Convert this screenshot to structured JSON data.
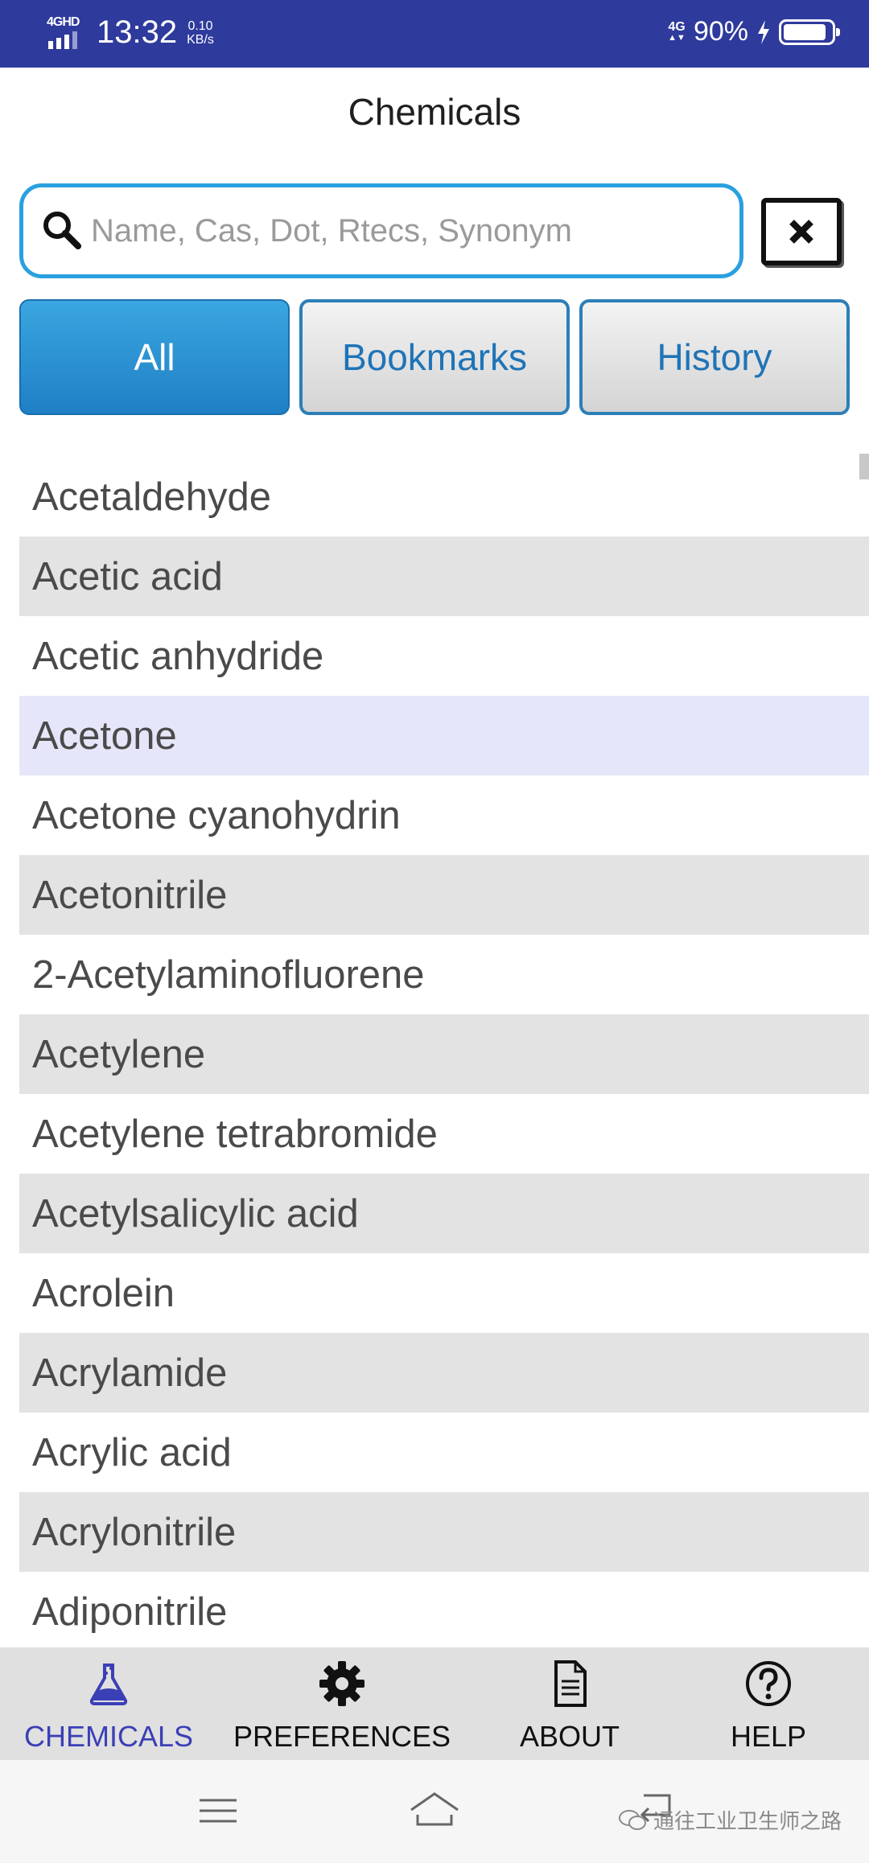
{
  "status_bar": {
    "network_tag": "4GHD",
    "time": "13:32",
    "speed_value": "0.10",
    "speed_unit": "KB/s",
    "network_right": "4G",
    "battery_percent": "90%",
    "battery_level": 0.9
  },
  "header": {
    "title": "Chemicals"
  },
  "search": {
    "placeholder": "Name, Cas, Dot, Rtecs, Synonym",
    "value": ""
  },
  "filters": {
    "all": "All",
    "bookmarks": "Bookmarks",
    "history": "History",
    "selected": "All"
  },
  "list": {
    "items": [
      "Acetaldehyde",
      "Acetic acid",
      "Acetic anhydride",
      "Acetone",
      "Acetone cyanohydrin",
      "Acetonitrile",
      "2-Acetylaminofluorene",
      "Acetylene",
      "Acetylene tetrabromide",
      "Acetylsalicylic acid",
      "Acrolein",
      "Acrylamide",
      "Acrylic acid",
      "Acrylonitrile",
      "Adiponitrile"
    ],
    "selected": "Acetone"
  },
  "bottom_nav": {
    "chemicals": "CHEMICALS",
    "preferences": "PREFERENCES",
    "about": "ABOUT",
    "help": "HELP",
    "active": "CHEMICALS"
  },
  "watermark": {
    "text": "通往工业卫生师之路"
  },
  "colors": {
    "status_bar": "#2e3a9c",
    "accent_blue": "#2aa0de",
    "active_nav": "#3b3fb6",
    "row_alt": "#e3e3e3",
    "row_selected": "#e6e6fa"
  },
  "icons": {
    "chemicals": "flask-icon",
    "preferences": "gear-icon",
    "about": "document-icon",
    "help": "question-circle-icon",
    "search": "search-icon",
    "clear": "close-icon"
  }
}
